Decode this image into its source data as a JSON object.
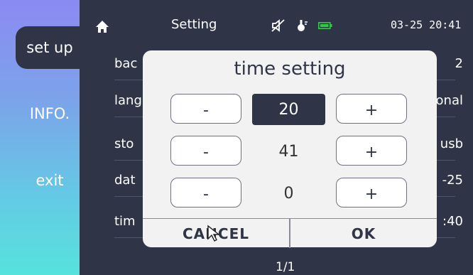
{
  "sidebar": {
    "items": [
      {
        "label": "set up"
      },
      {
        "label": "INFO."
      },
      {
        "label": "exit"
      }
    ]
  },
  "header": {
    "title": "Setting",
    "datetime": "03-25 20:41",
    "icons": [
      "home-icon",
      "mute-icon",
      "temperature-icon",
      "battery-icon"
    ]
  },
  "rows": [
    {
      "label": "bac",
      "value": "2"
    },
    {
      "label": "lang",
      "value": "onal"
    },
    {
      "label": "sto",
      "value": "usb"
    },
    {
      "label": "dat",
      "value": "-25"
    },
    {
      "label": "tim",
      "value": ":40"
    }
  ],
  "pager": "1/1",
  "dialog": {
    "title": "time setting",
    "minus_label": "-",
    "plus_label": "+",
    "values": [
      "20",
      "41",
      "0"
    ],
    "cancel_label": "CANCEL",
    "ok_label": "OK"
  },
  "colors": {
    "background": "#2f3546",
    "dialog": "#f2f2f2",
    "battery": "#2ecc40"
  }
}
